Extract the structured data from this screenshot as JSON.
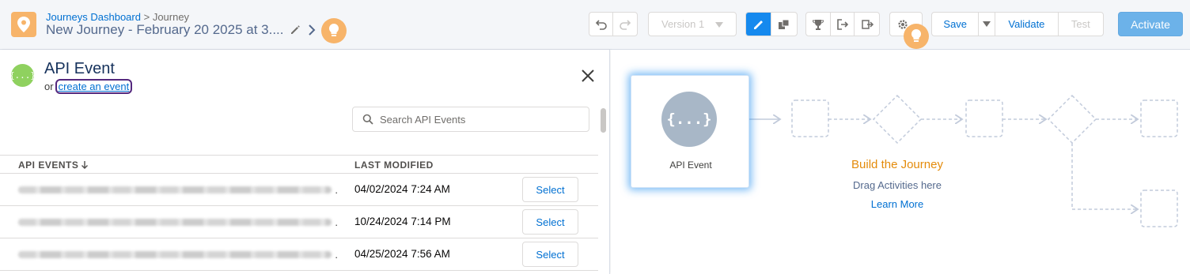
{
  "header": {
    "breadcrumb_parent": "Journeys Dashboard",
    "breadcrumb_separator": ">",
    "breadcrumb_current": "Journey",
    "title": "New Journey - February 20 2025 at 3....",
    "version_label": "Version 1",
    "save_label": "Save",
    "validate_label": "Validate",
    "test_label": "Test",
    "activate_label": "Activate",
    "icons": [
      "map-pin-icon",
      "pencil-icon",
      "chevron-right-icon",
      "lightbulb-icon",
      "undo-icon",
      "redo-icon",
      "edit-icon",
      "move-icon",
      "trophy-icon",
      "exit-icon",
      "sync-icon",
      "gear-icon"
    ]
  },
  "panel": {
    "icon_text": "{...}",
    "title": "API Event",
    "or_text": "or",
    "create_link": "create an event",
    "search_placeholder": "Search API Events",
    "columns": {
      "name": "API EVENTS",
      "modified": "LAST MODIFIED"
    },
    "rows": [
      {
        "modified": "04/02/2024 7:24 AM",
        "action": "Select"
      },
      {
        "modified": "10/24/2024 7:14 PM",
        "action": "Select"
      },
      {
        "modified": "04/25/2024 7:56 AM",
        "action": "Select"
      }
    ]
  },
  "canvas": {
    "entry_icon_text": "{...}",
    "entry_label": "API Event",
    "build_title": "Build the Journey",
    "build_sub": "Drag Activities here",
    "learn_more": "Learn More"
  },
  "colors": {
    "accent": "#1589ee",
    "link": "#0070d2",
    "brand_orange": "#f7b46a",
    "build_title": "#e48b0b",
    "api_event_green": "#8fd15f"
  }
}
